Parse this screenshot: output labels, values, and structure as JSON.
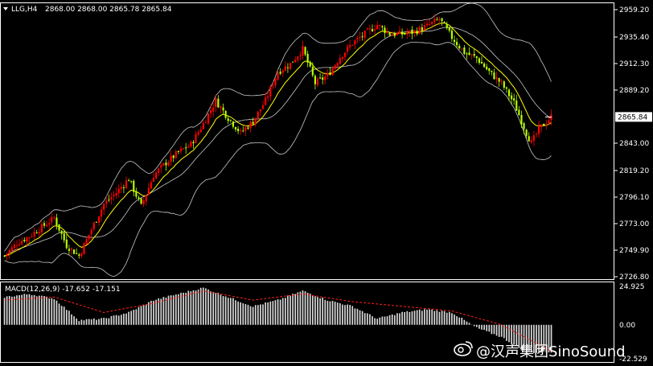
{
  "header": {
    "symbol": "LLG,H4",
    "ohlc": "2868.00 2868.00 2865.78 2865.84"
  },
  "colors": {
    "background": "#000000",
    "bull_candle": "#ff0000",
    "bear_candle": "#b7ff00",
    "bollinger": "#c8c8c8",
    "moving_average": "#ffff00",
    "macd_histogram": "#d9d9d9",
    "macd_signal": "#ff2020",
    "frame": "#ffffff"
  },
  "current_price_label": "2865.84",
  "macd": {
    "label": "MACD(12,26,9) -17.652 -17.151",
    "ticks": [
      "24.925",
      "0.00",
      "-22.529"
    ],
    "range": [
      -22.529,
      24.925
    ]
  },
  "watermark": {
    "icon": "weibo-icon",
    "text": "@汉声集团SinoSound"
  },
  "chart_data": {
    "type": "candlestick",
    "y_ticks": [
      "2959.20",
      "2935.40",
      "2912.30",
      "2889.20",
      "2865.84",
      "2843.00",
      "2819.20",
      "2796.10",
      "2773.00",
      "2749.90",
      "2726.80"
    ],
    "y_tick_values": [
      2959.2,
      2935.4,
      2912.3,
      2889.2,
      2865.84,
      2843.0,
      2819.2,
      2796.1,
      2773.0,
      2749.9,
      2726.8
    ],
    "ylim": [
      2726.8,
      2962.0
    ],
    "close_path": [
      [
        0,
        2745
      ],
      [
        5,
        2756
      ],
      [
        10,
        2762
      ],
      [
        15,
        2770
      ],
      [
        20,
        2778
      ],
      [
        25,
        2754
      ],
      [
        30,
        2745
      ],
      [
        35,
        2768
      ],
      [
        40,
        2790
      ],
      [
        45,
        2800
      ],
      [
        50,
        2812
      ],
      [
        55,
        2788
      ],
      [
        60,
        2815
      ],
      [
        65,
        2826
      ],
      [
        70,
        2835
      ],
      [
        75,
        2842
      ],
      [
        80,
        2860
      ],
      [
        85,
        2880
      ],
      [
        90,
        2865
      ],
      [
        95,
        2852
      ],
      [
        100,
        2862
      ],
      [
        105,
        2880
      ],
      [
        110,
        2905
      ],
      [
        115,
        2912
      ],
      [
        120,
        2925
      ],
      [
        125,
        2895
      ],
      [
        130,
        2902
      ],
      [
        135,
        2918
      ],
      [
        140,
        2930
      ],
      [
        145,
        2938
      ],
      [
        150,
        2946
      ],
      [
        155,
        2938
      ],
      [
        160,
        2938
      ],
      [
        165,
        2940
      ],
      [
        170,
        2945
      ],
      [
        175,
        2951
      ],
      [
        180,
        2935
      ],
      [
        185,
        2922
      ],
      [
        190,
        2917
      ],
      [
        195,
        2905
      ],
      [
        200,
        2895
      ],
      [
        205,
        2878
      ],
      [
        210,
        2852
      ],
      [
        212,
        2843
      ],
      [
        215,
        2855
      ],
      [
        220,
        2866
      ]
    ],
    "macd_path": [
      [
        0,
        18
      ],
      [
        10,
        20
      ],
      [
        20,
        17
      ],
      [
        30,
        3
      ],
      [
        40,
        4
      ],
      [
        50,
        8
      ],
      [
        60,
        16
      ],
      [
        70,
        20
      ],
      [
        80,
        24
      ],
      [
        90,
        18
      ],
      [
        100,
        12
      ],
      [
        110,
        16
      ],
      [
        120,
        22
      ],
      [
        130,
        16
      ],
      [
        140,
        12
      ],
      [
        150,
        4
      ],
      [
        160,
        8
      ],
      [
        170,
        10
      ],
      [
        180,
        8
      ],
      [
        190,
        -2
      ],
      [
        200,
        -8
      ],
      [
        210,
        -18
      ],
      [
        220,
        -17.6
      ]
    ],
    "signal_path": [
      [
        0,
        16
      ],
      [
        20,
        18
      ],
      [
        40,
        8
      ],
      [
        60,
        14
      ],
      [
        80,
        22
      ],
      [
        100,
        16
      ],
      [
        120,
        20
      ],
      [
        140,
        15
      ],
      [
        160,
        12
      ],
      [
        180,
        9
      ],
      [
        200,
        0
      ],
      [
        220,
        -17.2
      ]
    ]
  }
}
